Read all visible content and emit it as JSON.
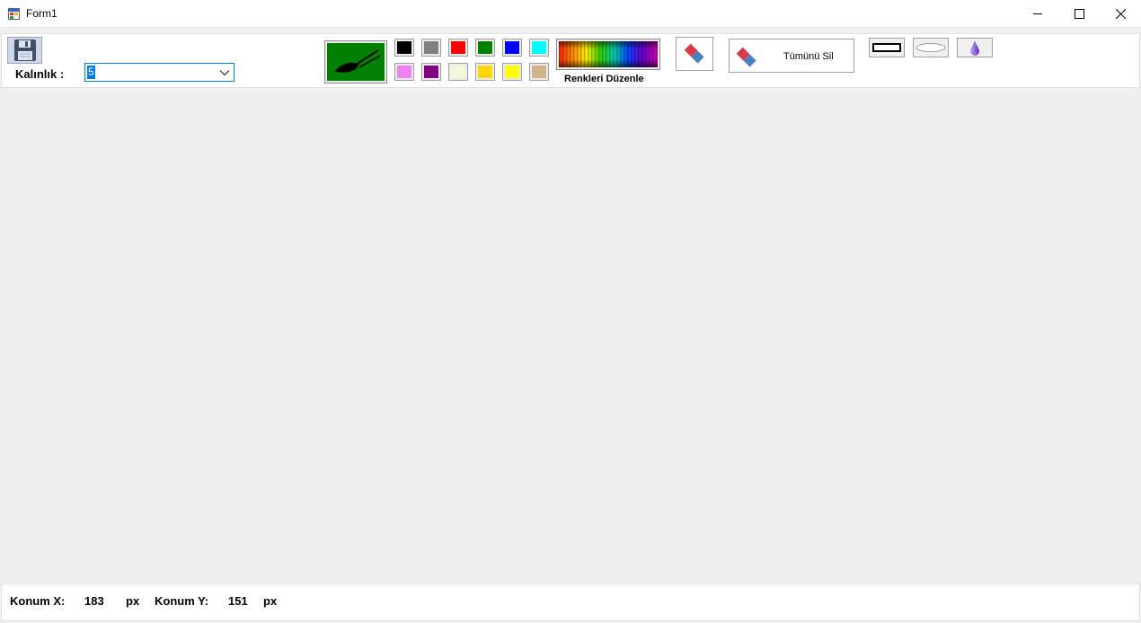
{
  "window": {
    "title": "Form1",
    "controls": {
      "minimize": "minimize-icon",
      "maximize": "maximize-icon",
      "close": "close-icon"
    }
  },
  "toolbar": {
    "save_icon": "floppy-disk-icon",
    "thickness_label": "Kalınlık :",
    "thickness_value": "5",
    "brush_icon": "paintbrush-icon",
    "brush_color": "#008000",
    "palette": [
      {
        "name": "black",
        "color": "#000000"
      },
      {
        "name": "gray",
        "color": "#808080"
      },
      {
        "name": "red",
        "color": "#ff0000"
      },
      {
        "name": "green",
        "color": "#008000"
      },
      {
        "name": "blue",
        "color": "#0000ff"
      },
      {
        "name": "cyan",
        "color": "#00ffff"
      },
      {
        "name": "violet",
        "color": "#ee82ee"
      },
      {
        "name": "purple",
        "color": "#800080"
      },
      {
        "name": "beige",
        "color": "#f5f5dc"
      },
      {
        "name": "gold",
        "color": "#ffd700"
      },
      {
        "name": "yellow",
        "color": "#ffff00"
      },
      {
        "name": "tan",
        "color": "#d2b48c"
      }
    ],
    "edit_colors_label": "Renkleri Düzenle",
    "eraser_icon": "eraser-icon",
    "clear_all_label": "Tümünü Sil",
    "shapes": [
      "rectangle-icon",
      "ellipse-icon",
      "drop-icon"
    ]
  },
  "status": {
    "x_label": "Konum X:",
    "x_value": "183",
    "x_unit": "px",
    "y_label": "Konum Y:",
    "y_value": "151",
    "y_unit": "px"
  }
}
